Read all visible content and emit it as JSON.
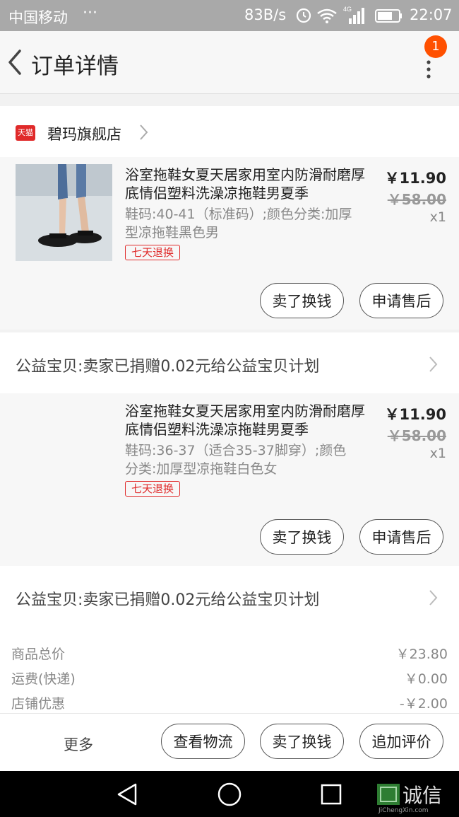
{
  "status_bar": {
    "carrier": "中国移动",
    "dots": "···",
    "speed": "83B/s",
    "time": "22:07",
    "signal_label": "4G"
  },
  "header": {
    "title": "订单详情",
    "notification_count": "1"
  },
  "shop": {
    "badge": "天猫",
    "name": "碧玛旗舰店"
  },
  "items": [
    {
      "title": "浴室拖鞋女夏天居家用室内防滑耐磨厚底情侣塑料洗澡凉拖鞋男夏季",
      "spec": "鞋码:40-41（标准码）;颜色分类:加厚型凉拖鞋黑色男",
      "tag": "七天退换",
      "price": "￥11.90",
      "original_price": "￥58.00",
      "quantity": "x1",
      "btn_sell": "卖了换钱",
      "btn_aftersale": "申请售后",
      "charity": "公益宝贝:卖家已捐赠0.02元给公益宝贝计划"
    },
    {
      "title": "浴室拖鞋女夏天居家用室内防滑耐磨厚底情侣塑料洗澡凉拖鞋男夏季",
      "spec": "鞋码:36-37（适合35-37脚穿）;颜色分类:加厚型凉拖鞋白色女",
      "tag": "七天退换",
      "price": "￥11.90",
      "original_price": "￥58.00",
      "quantity": "x1",
      "btn_sell": "卖了换钱",
      "btn_aftersale": "申请售后",
      "charity": "公益宝贝:卖家已捐赠0.02元给公益宝贝计划"
    }
  ],
  "summary": [
    {
      "label": "商品总价",
      "value": "￥23.80"
    },
    {
      "label": "运费(快递)",
      "value": "￥0.00"
    },
    {
      "label": "店铺优惠",
      "value": "-￥2.00"
    }
  ],
  "bottom_bar": {
    "more": "更多",
    "logistics": "查看物流",
    "sell": "卖了换钱",
    "review": "追加评价"
  },
  "watermark": {
    "text": "诚信",
    "sub": "JiChengXin.com"
  },
  "colors": {
    "accent": "#ff5000",
    "tag_red": "#e02a2a"
  }
}
